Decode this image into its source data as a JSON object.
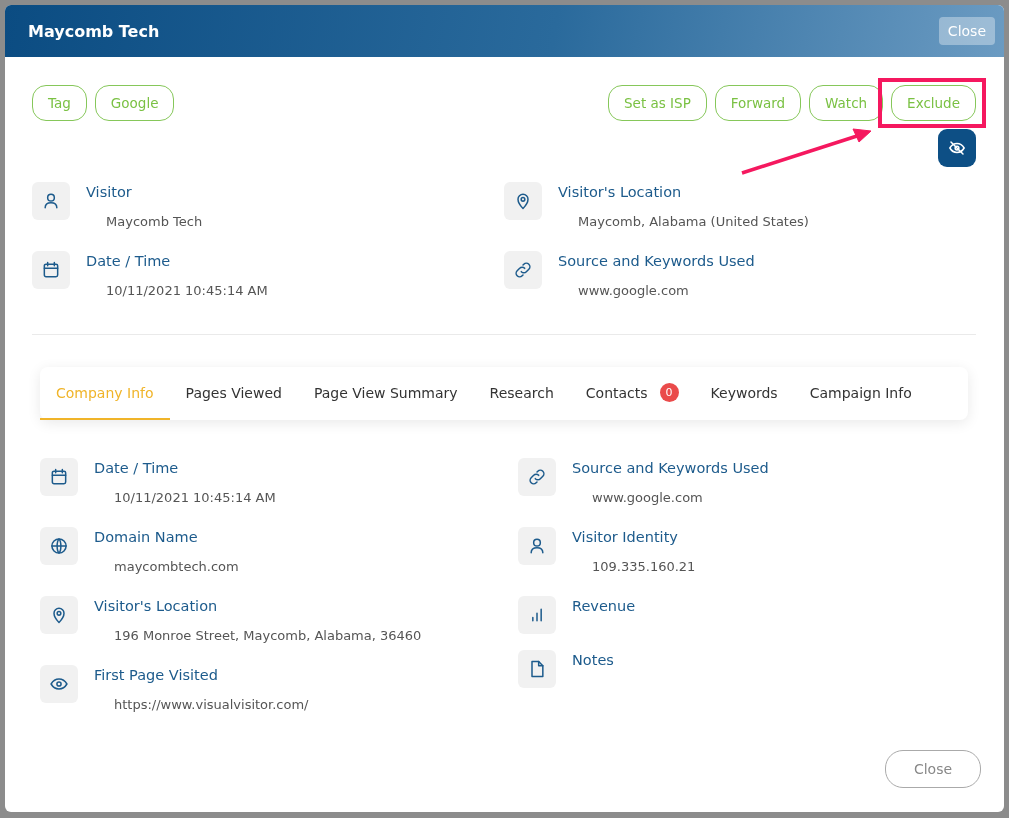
{
  "window": {
    "title": "Maycomb Tech",
    "close_button": "Close"
  },
  "left_actions": [
    "Tag",
    "Google"
  ],
  "right_actions": [
    "Set as ISP",
    "Forward",
    "Watch",
    "Exclude"
  ],
  "summary": {
    "columns": [
      [
        {
          "kind": "person",
          "label": "Visitor",
          "value": "Maycomb Tech"
        },
        {
          "kind": "calendar",
          "label": "Date / Time",
          "value": "10/11/2021 10:45:14 AM"
        }
      ],
      [
        {
          "kind": "pin",
          "label": "Visitor's Location",
          "value": "Maycomb, Alabama (United States)"
        },
        {
          "kind": "link",
          "label": "Source and Keywords Used",
          "value": "www.google.com"
        }
      ]
    ]
  },
  "tabs": [
    {
      "label": "Company Info",
      "selected": true
    },
    {
      "label": "Pages Viewed",
      "selected": false
    },
    {
      "label": "Page View Summary",
      "selected": false
    },
    {
      "label": "Research",
      "selected": false
    },
    {
      "label": "Contacts",
      "selected": false,
      "badge": "0"
    },
    {
      "label": "Keywords",
      "selected": false
    },
    {
      "label": "Campaign Info",
      "selected": false
    }
  ],
  "details": {
    "columns": [
      [
        {
          "kind": "calendar",
          "label": "Date / Time",
          "value": "10/11/2021 10:45:14 AM"
        },
        {
          "kind": "globe",
          "label": "Domain Name",
          "value": "maycombtech.com"
        },
        {
          "kind": "pin",
          "label": "Visitor's Location",
          "value": "196 Monroe Street, Maycomb, Alabama, 36460"
        },
        {
          "kind": "eye",
          "label": "First Page Visited",
          "value": "https://www.visualvisitor.com/"
        }
      ],
      [
        {
          "kind": "link",
          "label": "Source and Keywords Used",
          "value": "www.google.com"
        },
        {
          "kind": "person",
          "label": "Visitor Identity",
          "value": "109.335.160.21"
        },
        {
          "kind": "chart",
          "label": "Revenue"
        },
        {
          "kind": "file",
          "label": "Notes"
        }
      ]
    ]
  },
  "footer": {
    "close_button": "Close"
  }
}
